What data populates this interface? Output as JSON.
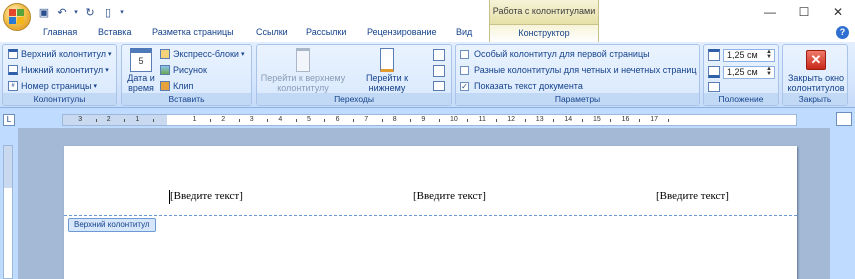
{
  "window": {
    "contextual_title": "Работа с колонтитулами",
    "controls": {
      "minimize": "—",
      "maximize": "☐",
      "close": "✕"
    }
  },
  "tabs": [
    "Главная",
    "Вставка",
    "Разметка страницы",
    "Ссылки",
    "Рассылки",
    "Рецензирование",
    "Вид"
  ],
  "active_tab": "Конструктор",
  "help_label": "?",
  "ribbon": {
    "groups": {
      "kolontituly": {
        "label": "Колонтитулы",
        "items": [
          "Верхний колонтитул",
          "Нижний колонтитул",
          "Номер страницы"
        ]
      },
      "vstavit": {
        "label": "Вставить",
        "date_time": "Дата и время",
        "express": "Экспресс-блоки",
        "picture": "Рисунок",
        "clip": "Клип"
      },
      "perehody": {
        "label": "Переходы",
        "to_header": "Перейти к верхнему колонтитулу",
        "to_footer": "Перейти к нижнему колонтитулу"
      },
      "parametry": {
        "label": "Параметры",
        "options": [
          {
            "label": "Особый колонтитул для первой страницы",
            "checked": false
          },
          {
            "label": "Разные колонтитулы для четных и нечетных страниц",
            "checked": false
          },
          {
            "label": "Показать текст документа",
            "checked": true
          }
        ]
      },
      "polozhenie": {
        "label": "Положение",
        "header_distance": "1,25 см",
        "footer_distance": "1,25 см"
      },
      "zakryt": {
        "label": "Закрыть",
        "close_button": "Закрыть окно колонтитулов"
      }
    }
  },
  "ruler": {
    "numbers": [
      "3",
      "2",
      "1",
      "1",
      "2",
      "3",
      "4",
      "5",
      "6",
      "7",
      "8",
      "9",
      "10",
      "11",
      "12",
      "13",
      "14",
      "15",
      "16",
      "17"
    ]
  },
  "document": {
    "header_placeholders": [
      "[Введите текст]",
      "[Введите текст]",
      "[Введите текст]"
    ],
    "header_tag": "Верхний колонтитул"
  }
}
